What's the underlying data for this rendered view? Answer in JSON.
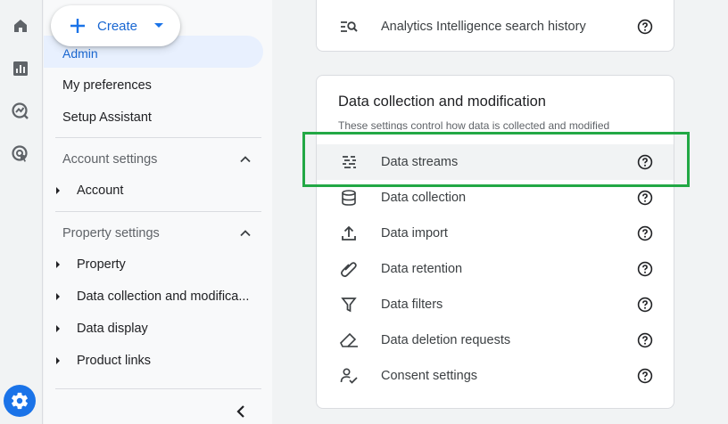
{
  "create_button": {
    "label": "Create"
  },
  "nav": {
    "selected_label": "Admin",
    "items": [
      "My preferences",
      "Setup Assistant"
    ],
    "account_section": {
      "title": "Account settings",
      "items": [
        "Account"
      ]
    },
    "property_section": {
      "title": "Property settings",
      "items": [
        "Property",
        "Data collection and modifica...",
        "Data display",
        "Product links"
      ]
    }
  },
  "top_card": {
    "row_label": "Analytics Intelligence search history"
  },
  "main_card": {
    "title": "Data collection and modification",
    "description": "These settings control how data is collected and modified",
    "rows": [
      {
        "label": "Data streams",
        "icon": "data-streams-icon"
      },
      {
        "label": "Data collection",
        "icon": "database-icon"
      },
      {
        "label": "Data import",
        "icon": "upload-icon"
      },
      {
        "label": "Data retention",
        "icon": "paperclip-icon"
      },
      {
        "label": "Data filters",
        "icon": "filter-icon"
      },
      {
        "label": "Data deletion requests",
        "icon": "eraser-icon"
      },
      {
        "label": "Consent settings",
        "icon": "consent-icon"
      }
    ]
  },
  "colors": {
    "accent": "#1a73e8",
    "highlight_border": "#22a845"
  }
}
